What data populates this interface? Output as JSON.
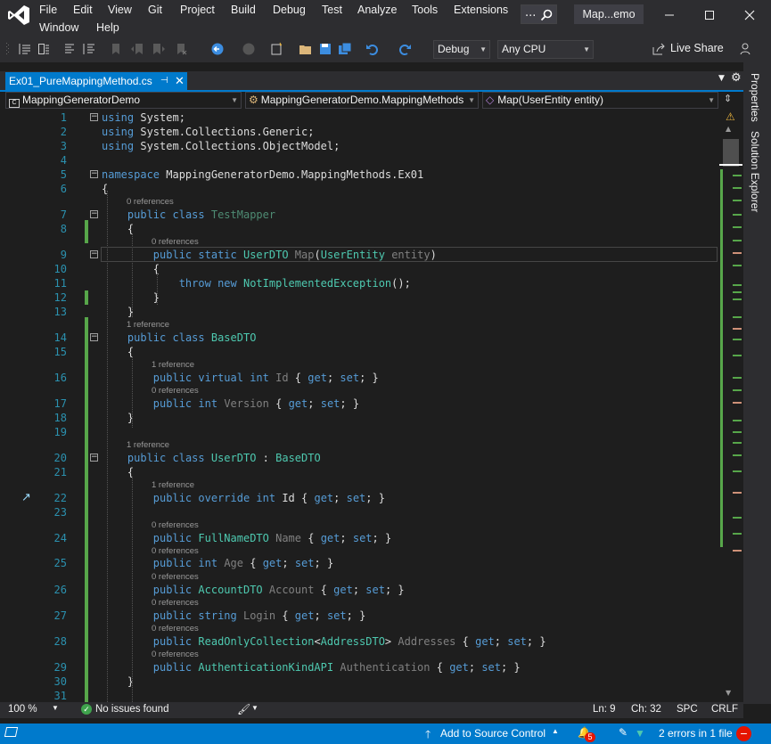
{
  "window": {
    "title": "Map...emo",
    "search_placeholder": "...",
    "accent": "#007acc"
  },
  "menu": [
    "File",
    "Edit",
    "View",
    "Git",
    "Project",
    "Build",
    "Debug",
    "Test",
    "Analyze",
    "Tools",
    "Extensions",
    "Window",
    "Help"
  ],
  "toolbar": {
    "config": "Debug",
    "platform": "Any CPU",
    "live_share": "Live Share"
  },
  "tab": {
    "name": "Ex01_PureMappingMethod.cs"
  },
  "nav": {
    "project": "MappingGeneratorDemo",
    "type": "MappingGeneratorDemo.MappingMethods",
    "member": "Map(UserEntity entity)"
  },
  "side_tabs": [
    "Properties",
    "Solution Explorer"
  ],
  "editor": {
    "line_numbers": [
      "1",
      "2",
      "3",
      "4",
      "5",
      "6",
      "7",
      "8",
      "9",
      "10",
      "11",
      "12",
      "13",
      "14",
      "15",
      "16",
      "17",
      "18",
      "19",
      "20",
      "21",
      "22",
      "23",
      "24",
      "25",
      "26",
      "27",
      "28",
      "29",
      "30",
      "31"
    ],
    "lens": {
      "r0": "0 references",
      "r1": "1 reference"
    }
  },
  "bottom": {
    "zoom": "100 %",
    "issues": "No issues found",
    "ln": "Ln: 9",
    "ch": "Ch: 32",
    "spc": "SPC",
    "crlf": "CRLF"
  },
  "status": {
    "source_control": "Add to Source Control",
    "errors": "2 errors in 1 file",
    "error_badge": "5"
  }
}
